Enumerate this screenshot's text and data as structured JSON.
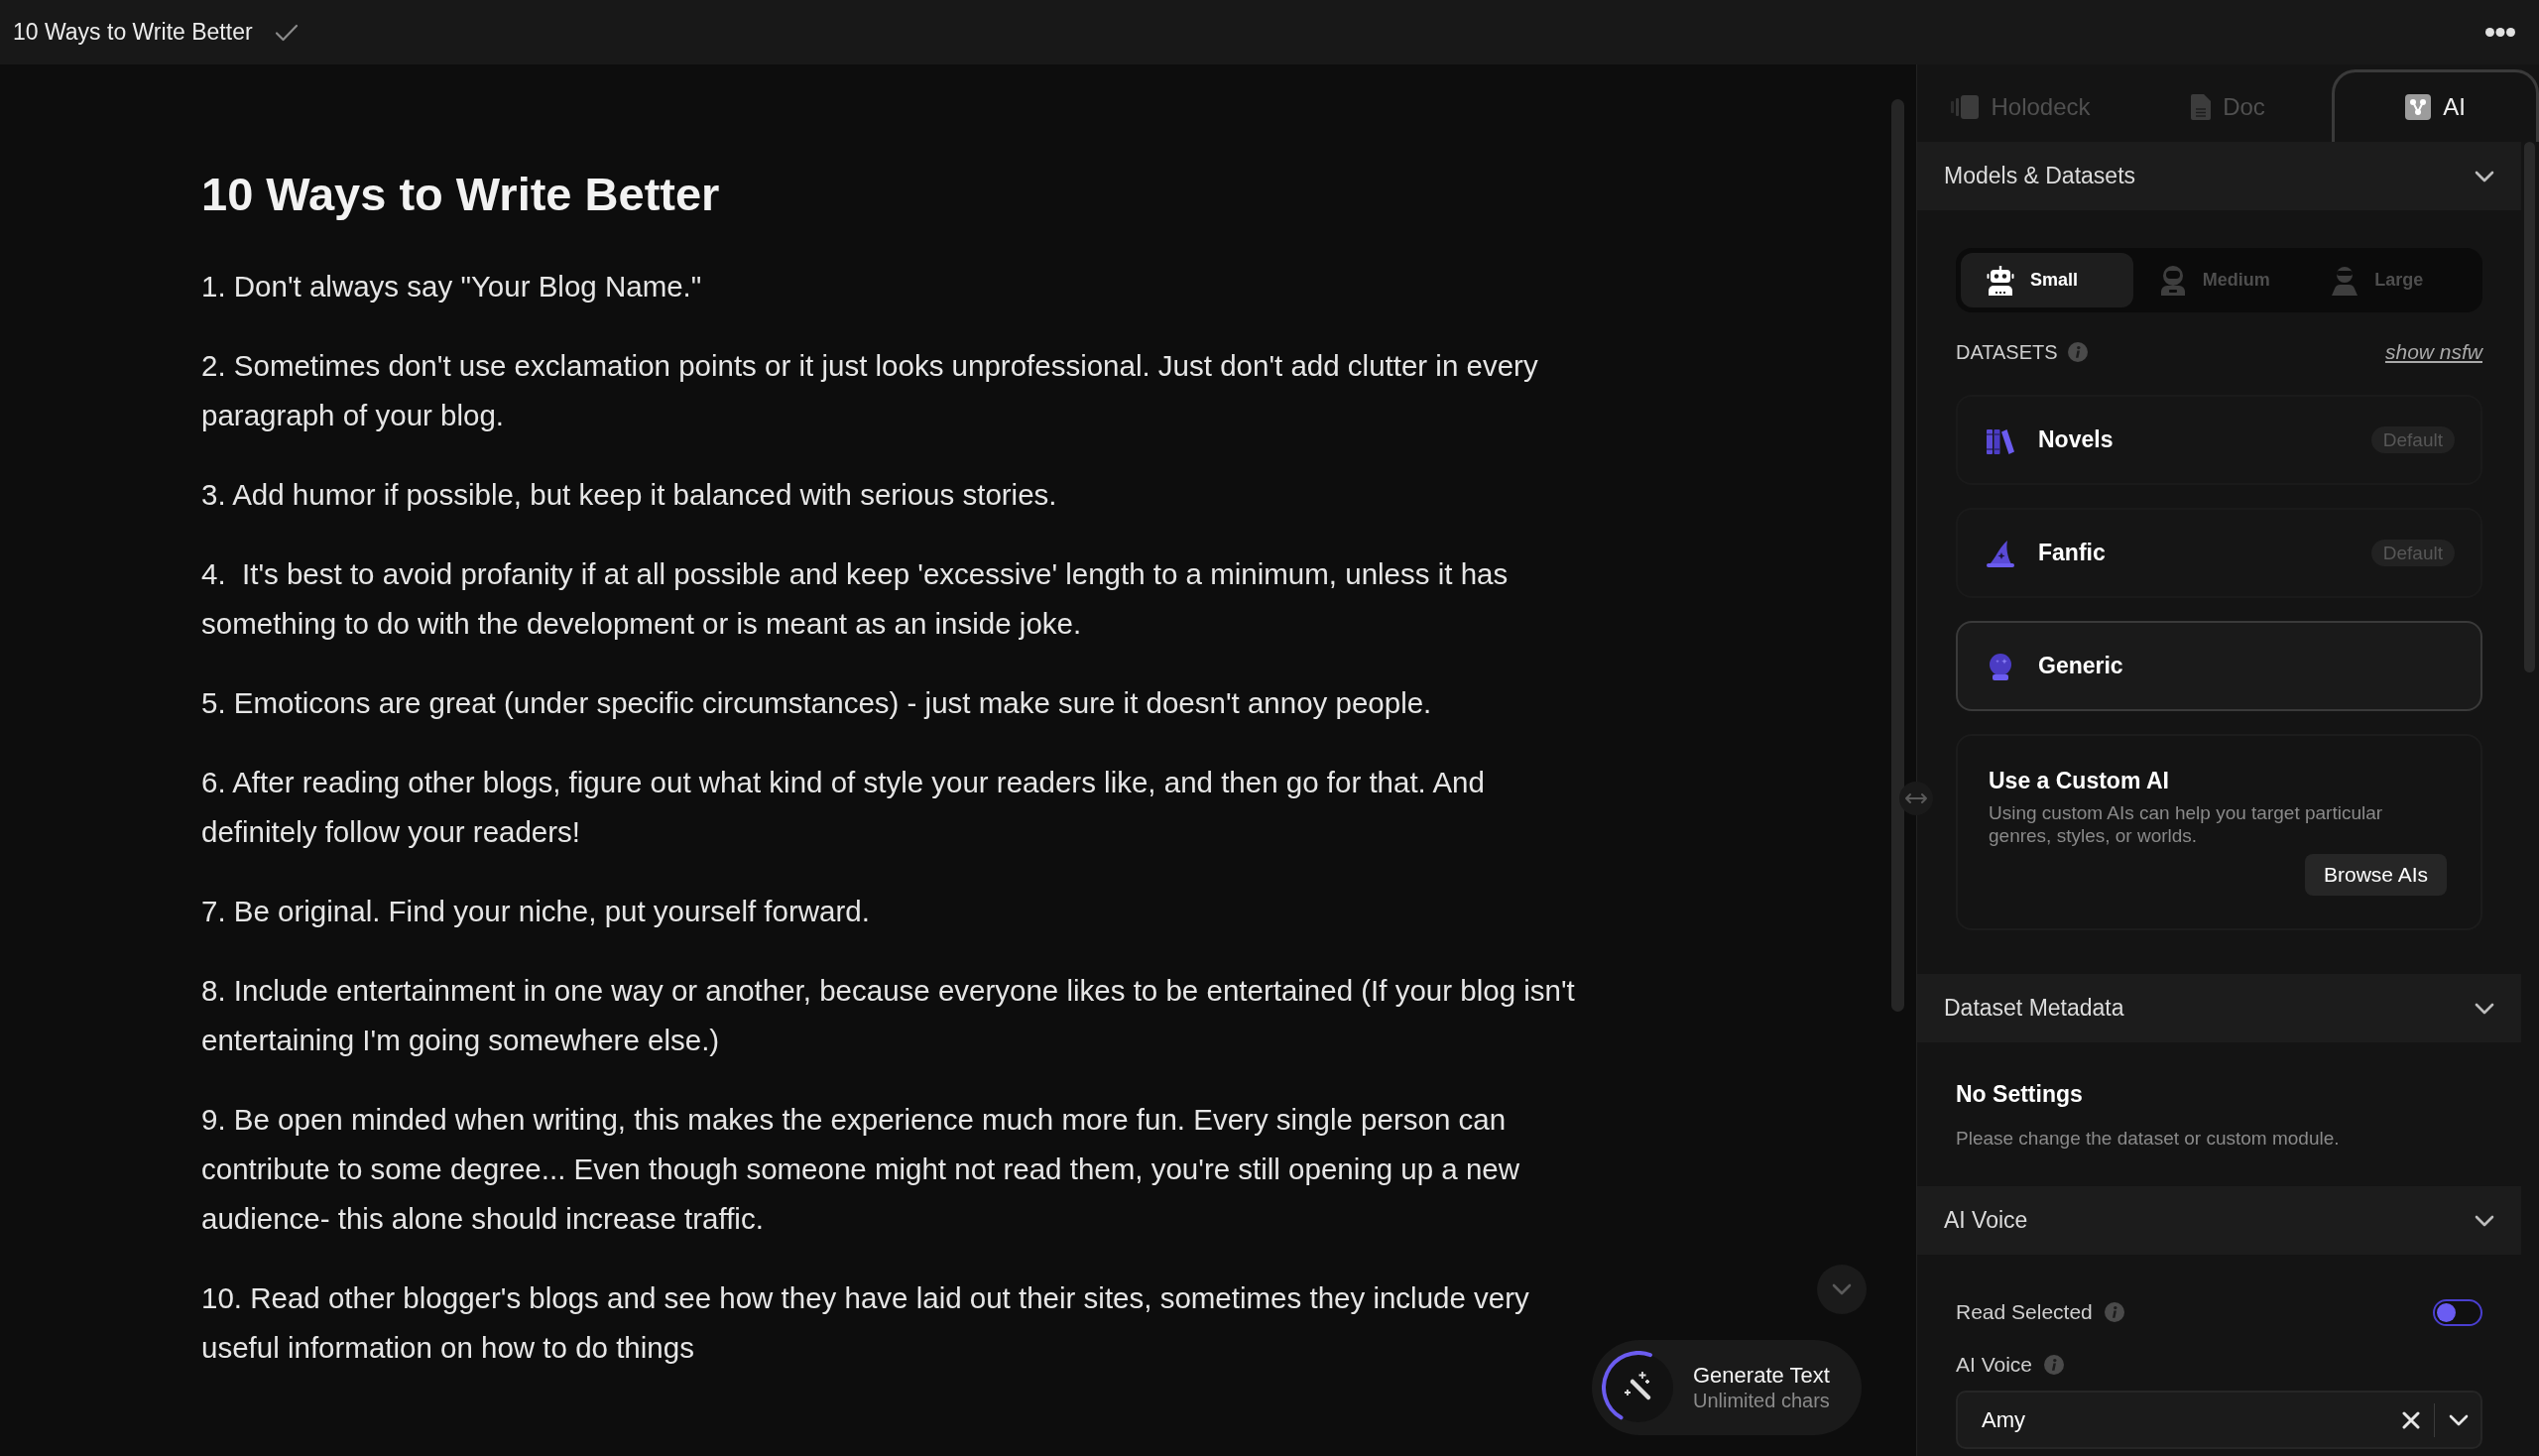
{
  "title_bar": {
    "title": "10 Ways to Write Better",
    "saved": true
  },
  "document": {
    "heading": "10 Ways to Write Better",
    "paragraphs": [
      "1. Don't always say \"Your Blog Name.\"",
      "2. Sometimes don't use exclamation points or it just looks unprofessional. Just don't add clutter in every paragraph of your blog.",
      "3. Add humor if possible, but keep it balanced with serious stories.",
      "4.  It's best to avoid profanity if at all possible and keep 'excessive' length to a minimum, unless it has something to do with the development or is meant as an inside joke.",
      "5. Emoticons are great (under specific circumstances) - just make sure it doesn't annoy people.",
      "6. After reading other blogs, figure out what kind of style your readers like, and then go for that. And definitely follow your readers!",
      "7. Be original. Find your niche, put yourself forward.",
      "8. Include entertainment in one way or another, because everyone likes to be entertained (If your blog isn't entertaining I'm going somewhere else.)",
      "9. Be open minded when writing, this makes the experience much more fun. Every single person can contribute to some degree... Even though someone might not read them, you're still opening up a new audience- this alone should increase traffic.",
      "10. Read other blogger's blogs and see how they have laid out their sites, sometimes they include very useful information on how to do things"
    ]
  },
  "generate_button": {
    "label": "Generate Text",
    "sublabel": "Unlimited chars"
  },
  "side_panel": {
    "tabs": [
      {
        "label": "Holodeck",
        "selected": false
      },
      {
        "label": "Doc",
        "selected": false
      },
      {
        "label": "AI",
        "selected": true
      }
    ],
    "models_and_datasets": {
      "title": "Models & Datasets",
      "expanded": true,
      "models": [
        {
          "label": "Small",
          "selected": true
        },
        {
          "label": "Medium",
          "selected": false
        },
        {
          "label": "Large",
          "selected": false
        }
      ],
      "datasets_label": "DATASETS",
      "show_nsfw": "show nsfw",
      "datasets": [
        {
          "name": "Novels",
          "badge": "Default",
          "selected": false
        },
        {
          "name": "Fanfic",
          "badge": "Default",
          "selected": false
        },
        {
          "name": "Generic",
          "selected": true
        }
      ],
      "custom_ai": {
        "title": "Use a Custom AI",
        "description": "Using custom AIs can help you target particular genres, styles, or worlds.",
        "button": "Browse AIs"
      }
    },
    "dataset_metadata": {
      "title": "Dataset Metadata",
      "expanded": true,
      "heading": "No Settings",
      "message": "Please change the dataset or custom module."
    },
    "ai_voice": {
      "title": "AI Voice",
      "expanded": true,
      "read_selected": {
        "label": "Read Selected",
        "on": false
      },
      "voice": {
        "label": "AI Voice",
        "value": "Amy"
      }
    }
  }
}
